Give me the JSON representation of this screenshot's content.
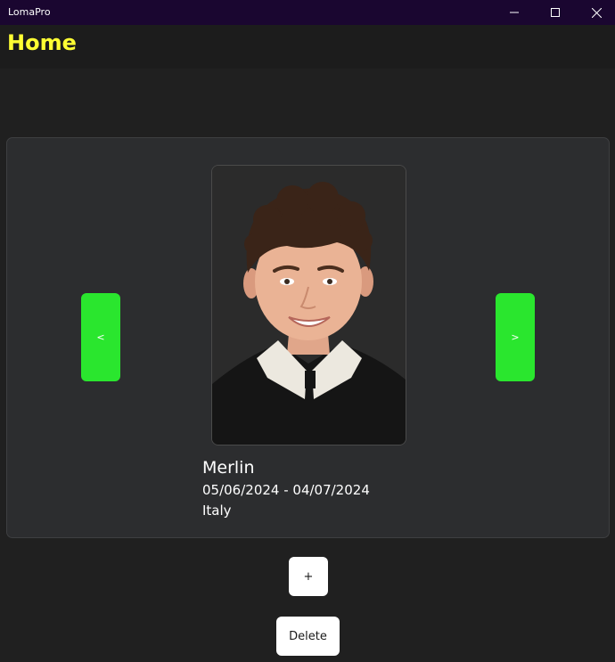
{
  "window": {
    "app_title": "LomaPro",
    "controls": [
      "minimize-icon",
      "maximize-icon",
      "close-icon"
    ]
  },
  "header": {
    "title": "Home",
    "title_color": "#ffff33"
  },
  "carousel": {
    "prev_label": "<",
    "next_label": ">",
    "nav_color": "#2ae62e",
    "person": {
      "name": "Merlin",
      "dates": "05/06/2024 - 04/07/2024",
      "country": "Italy"
    }
  },
  "actions": {
    "add_label": "+",
    "delete_label": "Delete"
  },
  "colors": {
    "background": "#202020",
    "card": "#2c2d2f",
    "titlebar": "#1a0630"
  }
}
